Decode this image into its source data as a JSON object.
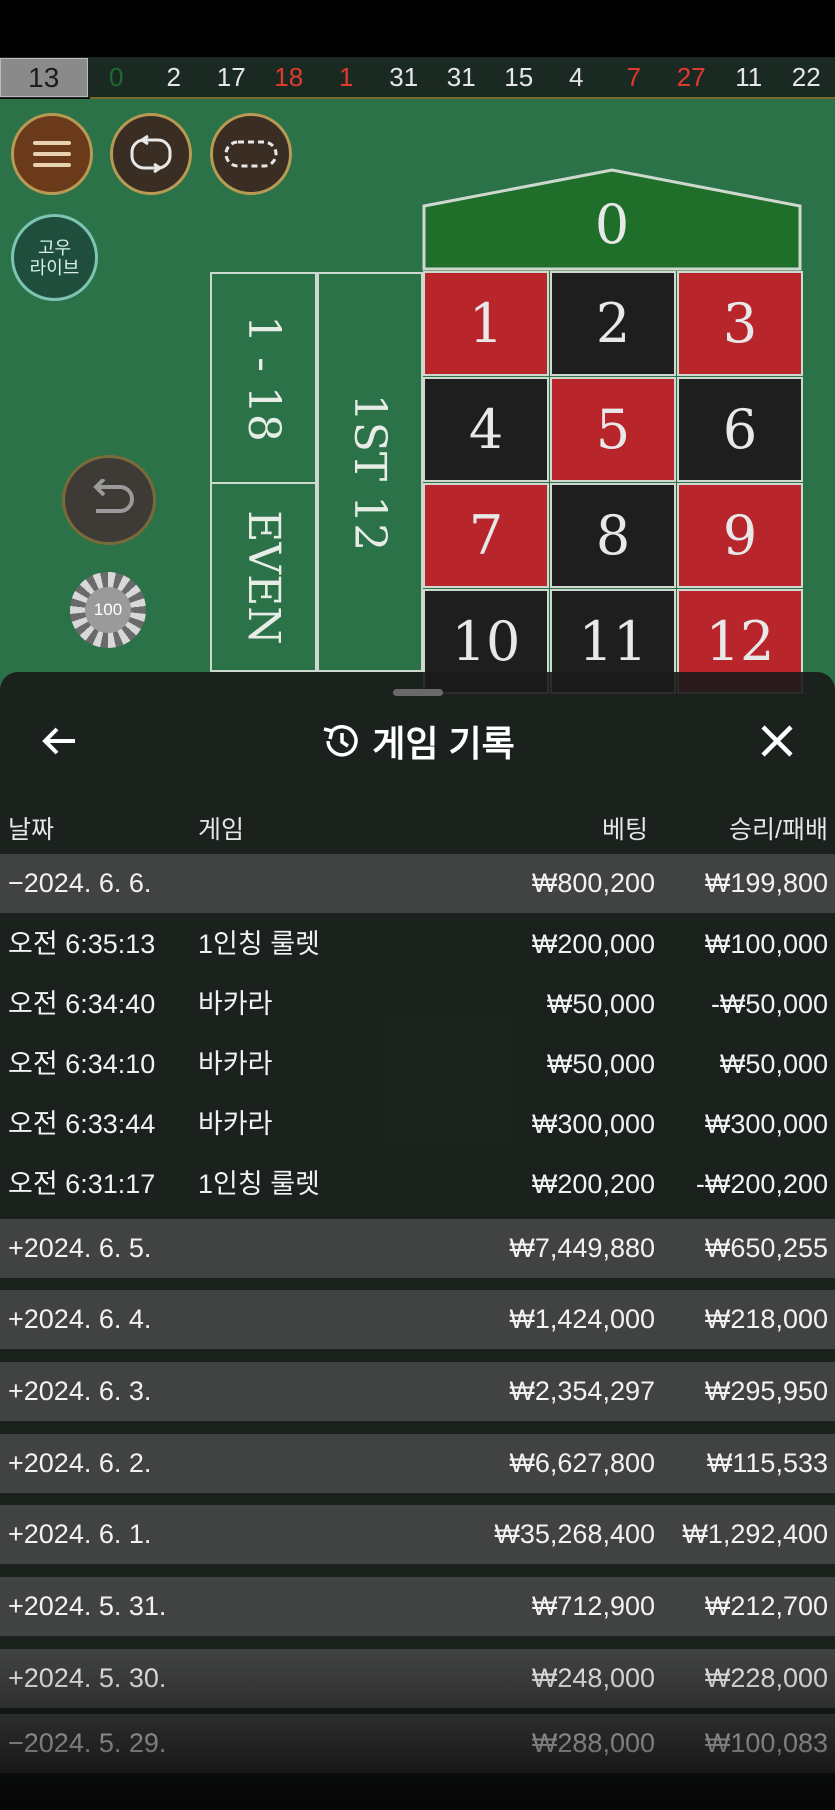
{
  "history": {
    "current": "13",
    "numbers": [
      {
        "n": "0",
        "color": "green"
      },
      {
        "n": "2",
        "color": "black"
      },
      {
        "n": "17",
        "color": "black"
      },
      {
        "n": "18",
        "color": "red"
      },
      {
        "n": "1",
        "color": "red"
      },
      {
        "n": "31",
        "color": "black"
      },
      {
        "n": "31",
        "color": "black"
      },
      {
        "n": "15",
        "color": "black"
      },
      {
        "n": "4",
        "color": "black"
      },
      {
        "n": "7",
        "color": "red"
      },
      {
        "n": "27",
        "color": "red"
      },
      {
        "n": "11",
        "color": "black"
      },
      {
        "n": "22",
        "color": "black"
      }
    ]
  },
  "controls": {
    "logo_line1": "고우",
    "logo_line2": "라이브",
    "chip_value": "100"
  },
  "table": {
    "zero": "0",
    "low": "1 - 18",
    "even": "EVEN",
    "dozen": "1ST 12",
    "rows": [
      [
        {
          "n": "1",
          "c": "red"
        },
        {
          "n": "2",
          "c": "black"
        },
        {
          "n": "3",
          "c": "red"
        }
      ],
      [
        {
          "n": "4",
          "c": "black"
        },
        {
          "n": "5",
          "c": "red"
        },
        {
          "n": "6",
          "c": "black"
        }
      ],
      [
        {
          "n": "7",
          "c": "red"
        },
        {
          "n": "8",
          "c": "black"
        },
        {
          "n": "9",
          "c": "red"
        }
      ],
      [
        {
          "n": "10",
          "c": "black"
        },
        {
          "n": "11",
          "c": "black"
        },
        {
          "n": "12",
          "c": "red"
        }
      ]
    ]
  },
  "sheet": {
    "title": "게임 기록",
    "columns": {
      "date": "날짜",
      "game": "게임",
      "bet": "베팅",
      "winloss": "승리/패배"
    },
    "rows": [
      {
        "type": "date",
        "date": "−2024. 6. 6.",
        "game": "",
        "bet": "₩800,200",
        "winloss": "₩199,800"
      },
      {
        "type": "detail",
        "date": "오전 6:35:13",
        "game": "1인칭 룰렛",
        "bet": "₩200,000",
        "winloss": "₩100,000"
      },
      {
        "type": "detail",
        "date": "오전 6:34:40",
        "game": "바카라",
        "bet": "₩50,000",
        "winloss": "-₩50,000"
      },
      {
        "type": "detail",
        "date": "오전 6:34:10",
        "game": "바카라",
        "bet": "₩50,000",
        "winloss": "₩50,000"
      },
      {
        "type": "detail",
        "date": "오전 6:33:44",
        "game": "바카라",
        "bet": "₩300,000",
        "winloss": "₩300,000"
      },
      {
        "type": "detail",
        "date": "오전 6:31:17",
        "game": "1인칭 룰렛",
        "bet": "₩200,200",
        "winloss": "-₩200,200"
      },
      {
        "type": "date",
        "date": "+2024. 6. 5.",
        "game": "",
        "bet": "₩7,449,880",
        "winloss": "₩650,255"
      },
      {
        "type": "date",
        "date": "+2024. 6. 4.",
        "game": "",
        "bet": "₩1,424,000",
        "winloss": "₩218,000"
      },
      {
        "type": "date",
        "date": "+2024. 6. 3.",
        "game": "",
        "bet": "₩2,354,297",
        "winloss": "₩295,950"
      },
      {
        "type": "date",
        "date": "+2024. 6. 2.",
        "game": "",
        "bet": "₩6,627,800",
        "winloss": "₩115,533"
      },
      {
        "type": "date",
        "date": "+2024. 6. 1.",
        "game": "",
        "bet": "₩35,268,400",
        "winloss": "₩1,292,400"
      },
      {
        "type": "date",
        "date": "+2024. 5. 31.",
        "game": "",
        "bet": "₩712,900",
        "winloss": "₩212,700"
      },
      {
        "type": "date",
        "date": "+2024. 5. 30.",
        "game": "",
        "bet": "₩248,000",
        "winloss": "₩228,000"
      },
      {
        "type": "date",
        "date": "−2024. 5. 29.",
        "game": "",
        "bet": "₩288,000",
        "winloss": "₩100,083"
      }
    ]
  }
}
